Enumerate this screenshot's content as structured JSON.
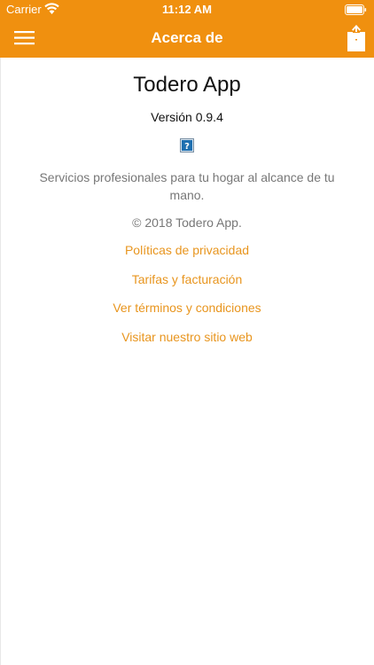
{
  "status_bar": {
    "carrier": "Carrier",
    "time": "11:12 AM",
    "icons": [
      "wifi-icon",
      "battery-icon"
    ]
  },
  "nav_bar": {
    "title": "Acerca de",
    "left_icon": "hamburger-menu-icon",
    "right_icon": "share-icon",
    "background_color": "#F0900F"
  },
  "about": {
    "app_name": "Todero App",
    "version": "Versión 0.9.4",
    "icon": "broken-image-question-icon",
    "description": "Servicios profesionales para tu hogar al alcance de tu mano.",
    "copyright": "© 2018 Todero App.",
    "links": [
      {
        "label": "Políticas de privacidad"
      },
      {
        "label": "Tarifas y facturación"
      },
      {
        "label": "Ver términos y condiciones"
      },
      {
        "label": "Visitar nuestro sitio web"
      }
    ],
    "link_color": "#E8951E"
  }
}
